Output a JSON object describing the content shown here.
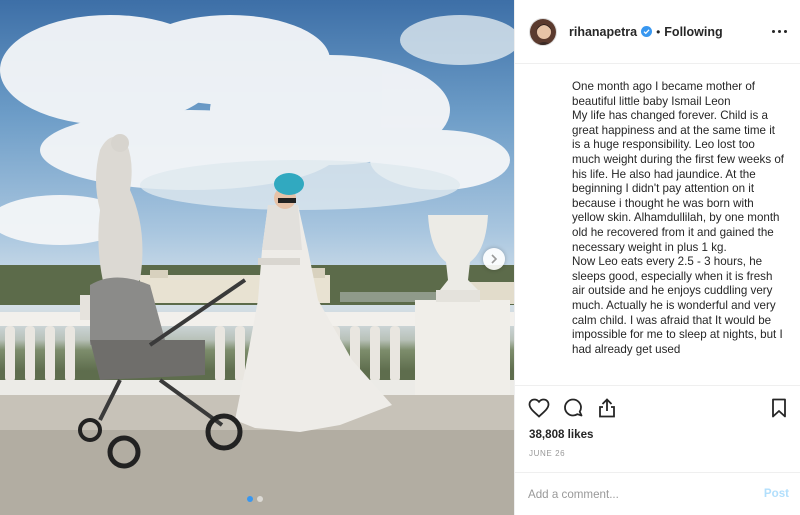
{
  "post": {
    "username": "rihanapetra",
    "verified": true,
    "separator": "•",
    "follow_state": "Following",
    "caption_partial_top": "",
    "caption": "One month ago I became mother of beautiful little baby Ismail Leon\nMy life has changed forever. Child is a great happiness and at the same time it is a huge responsibility. Leo lost too much weight during the first few weeks of his life. He also had jaundice. At the beginning I didn't pay attention on it because i thought he was born with yellow skin. Alhamdullilah, by one month old he recovered from it and gained the necessary weight in plus 1 kg.\nNow Leo eats every 2.5 - 3 hours, he sleeps good, especially when it is fresh air outside and he enjoys cuddling very much. Actually he is wonderful and very calm child. I was afraid that It would be impossible for me to sleep at nights, but I had already get used",
    "likes": "38,808 likes",
    "date": "JUNE 26"
  },
  "comment": {
    "placeholder": "Add a comment...",
    "post_label": "Post"
  },
  "carousel": {
    "slides": 2,
    "active": 0
  },
  "icons": {
    "like": "heart-icon",
    "comment": "comment-icon",
    "share": "share-icon",
    "save": "bookmark-icon",
    "more": "more-options-icon",
    "next": "chevron-right-icon",
    "verified": "verified-badge-icon"
  },
  "colors": {
    "verified_blue": "#3897f0",
    "post_button_disabled": "#b2dffc",
    "border": "#efefef"
  }
}
